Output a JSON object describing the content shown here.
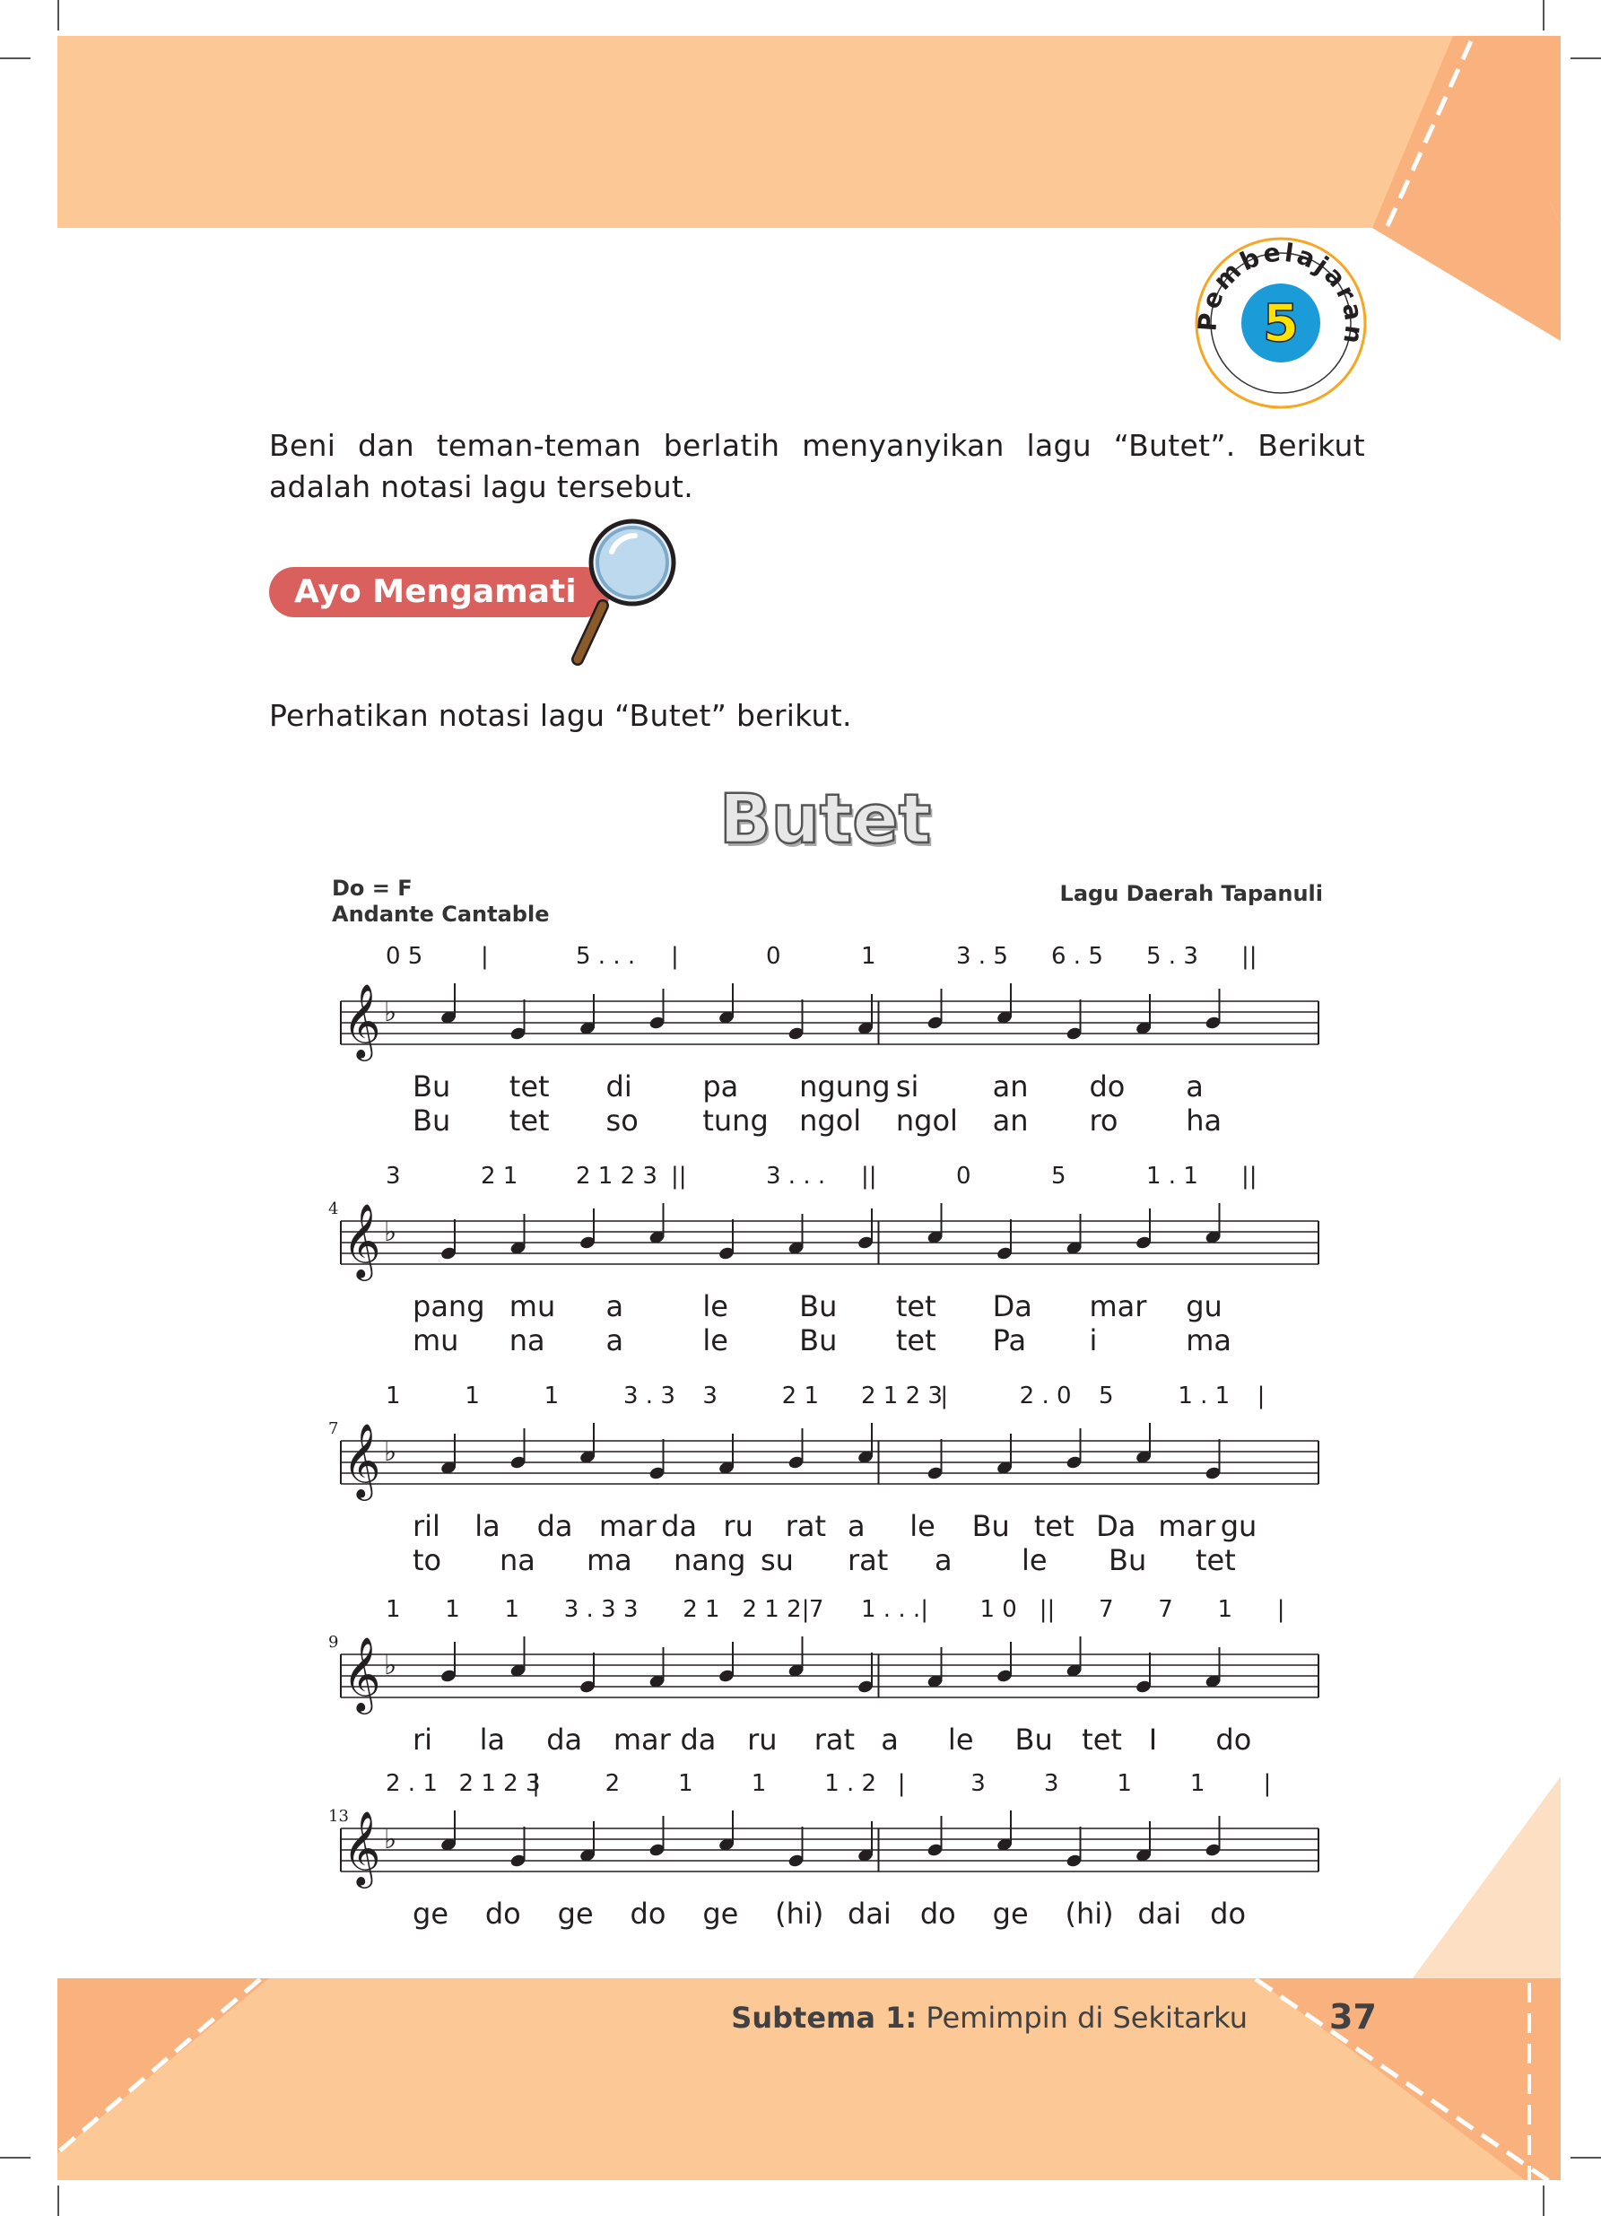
{
  "badge": {
    "label": "Pembelajaran",
    "number": "5"
  },
  "intro": "Beni dan teman-teman berlatih menyanyikan lagu “Butet”. Berikut adalah notasi lagu tersebut.",
  "section": {
    "label": "Ayo Mengamati",
    "icon": "magnifier-icon"
  },
  "instruction": "Perhatikan notasi lagu “Butet” berikut.",
  "song": {
    "title": "Butet",
    "key": "Do = F",
    "tempo": "Andante Cantable",
    "origin": "Lagu Daerah Tapanuli"
  },
  "score": {
    "systems": [
      {
        "number": "",
        "cipher": [
          "0 5",
          "|",
          "5 . . .",
          "|",
          "0",
          "1",
          "3 . 5",
          "6 . 5",
          "5 . 3",
          "||"
        ],
        "lyrics": [
          [
            "Bu",
            "tet",
            "di",
            "pa",
            "ngung",
            "si",
            "an",
            "do",
            "a"
          ],
          [
            "Bu",
            "tet",
            "so",
            "tung",
            "ngol",
            "ngol",
            "an",
            "ro",
            "ha"
          ]
        ]
      },
      {
        "number": "4",
        "cipher": [
          "3",
          "2 1",
          "2 1 2 3",
          "||",
          "3 . . .",
          "||",
          "0",
          "5",
          "1 . 1",
          "||"
        ],
        "lyrics": [
          [
            "pang",
            "mu",
            "a",
            "le",
            "Bu",
            "tet",
            "Da",
            "mar",
            "gu"
          ],
          [
            "mu",
            "na",
            "a",
            "le",
            "Bu",
            "tet",
            "Pa",
            "i",
            "ma"
          ]
        ]
      },
      {
        "number": "7",
        "cipher": [
          "1",
          "1",
          "1",
          "3 . 3",
          "3",
          "2 1",
          "2 1 2 3",
          "|",
          "2 . 0",
          "5",
          "1 . 1",
          "|"
        ],
        "lyrics": [
          [
            "ril",
            "la",
            "da",
            "mar",
            "da",
            "ru",
            "rat",
            "a",
            "le",
            "Bu",
            "tet",
            "Da",
            "mar",
            "gu"
          ],
          [
            "to",
            "na",
            "ma",
            "nang",
            "su",
            "rat",
            "a",
            "le",
            "Bu",
            "tet"
          ]
        ]
      },
      {
        "number": "9",
        "cipher": [
          "1",
          "1",
          "1",
          "3 . 3",
          "3",
          "2 1",
          "2 1 2 7",
          "|",
          "1 . . .",
          "|",
          "1 0",
          "||",
          "7",
          "7",
          "1",
          "|"
        ],
        "lyrics": [
          [
            "ri",
            "la",
            "da",
            "mar",
            "da",
            "ru",
            "rat",
            "a",
            "le",
            "Bu",
            "tet",
            "I",
            "do"
          ]
        ]
      },
      {
        "number": "13",
        "cipher": [
          "2 . 1",
          "2 1 2 3",
          "|",
          "2",
          "1",
          "1",
          "1 . 2",
          "|",
          "3",
          "3",
          "1",
          "1",
          "|"
        ],
        "lyrics": [
          [
            "ge",
            "do",
            "ge",
            "do",
            "ge",
            "(hi)",
            "dai",
            "do",
            "ge",
            "(hi)",
            "dai",
            "do"
          ]
        ]
      }
    ]
  },
  "footer": {
    "subtema_bold": "Subtema 1:",
    "subtema_text": "Pemimpin di Sekitarku",
    "page": "37"
  },
  "colors": {
    "band": "#fbc896",
    "triangle": "#f9b27e",
    "pill": "#d9605c",
    "badge_blue": "#1b9bd7",
    "badge_yellow": "#ffe200"
  }
}
